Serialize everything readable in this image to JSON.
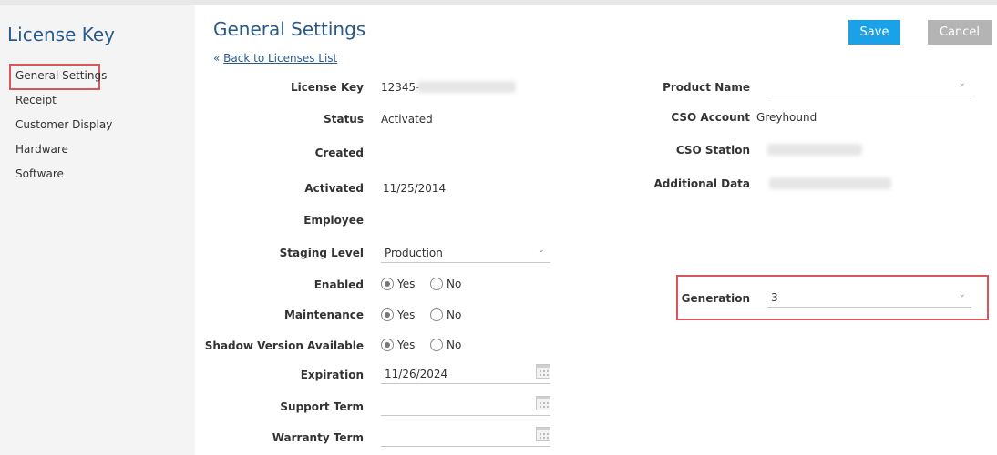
{
  "sidebar": {
    "title": "License Key",
    "items": [
      {
        "label": "General Settings"
      },
      {
        "label": "Receipt"
      },
      {
        "label": "Customer Display"
      },
      {
        "label": "Hardware"
      },
      {
        "label": "Software"
      }
    ]
  },
  "header": {
    "title": "General Settings",
    "back_arrow": "«",
    "back_link": "Back to Licenses List",
    "save_label": "Save",
    "cancel_label": "Cancel"
  },
  "left_fields": {
    "license_key_label": "License Key",
    "license_key_value": "12345-",
    "status_label": "Status",
    "status_value": "Activated",
    "created_label": "Created",
    "activated_label": "Activated",
    "activated_value": "11/25/2014",
    "employee_label": "Employee",
    "staging_label": "Staging Level",
    "staging_value": "Production",
    "enabled_label": "Enabled",
    "maintenance_label": "Maintenance",
    "shadow_label": "Shadow Version Available",
    "yes_label": "Yes",
    "no_label": "No",
    "expiration_label": "Expiration",
    "expiration_value": "11/26/2024",
    "support_label": "Support Term",
    "warranty_label": "Warranty Term"
  },
  "right_fields": {
    "product_label": "Product Name",
    "cso_account_label": "CSO Account",
    "cso_account_value": "Greyhound",
    "cso_station_label": "CSO Station",
    "additional_label": "Additional Data",
    "generation_label": "Generation",
    "generation_value": "3"
  },
  "icons": {
    "chevron": "chevron-down-icon",
    "calendar": "calendar-icon"
  },
  "colors": {
    "accent": "#2a5a8a",
    "save": "#1aa1e8",
    "cancel": "#b4b4b4",
    "highlight": "#d9575c"
  }
}
